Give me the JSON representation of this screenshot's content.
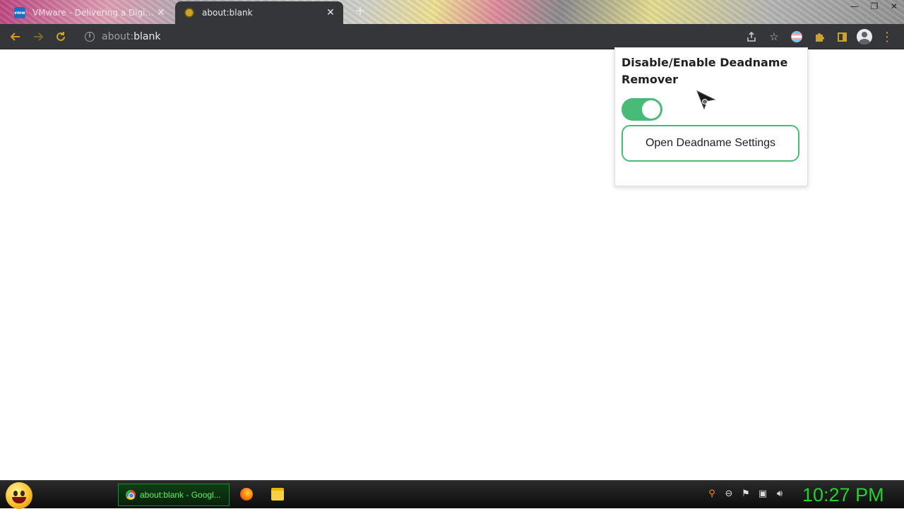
{
  "browser": {
    "tabs": [
      {
        "title": "VMware - Delivering a Digital Fo...",
        "favicon_label": "vmw",
        "active": false
      },
      {
        "title": "about:blank",
        "active": true
      }
    ],
    "new_tab_symbol": "+",
    "window_controls": [
      "—",
      "❐",
      "✕"
    ],
    "address": {
      "scheme": "about:",
      "host": "blank"
    }
  },
  "popup": {
    "title": "Disable/Enable Deadname Remover",
    "toggle_on": true,
    "settings_button_label": "Open Deadname Settings",
    "accent_color": "#48bb78"
  },
  "taskbar": {
    "task_item_title": "about:blank - Googl...",
    "clock": "10:27 PM",
    "clock_color": "#22d32c"
  }
}
